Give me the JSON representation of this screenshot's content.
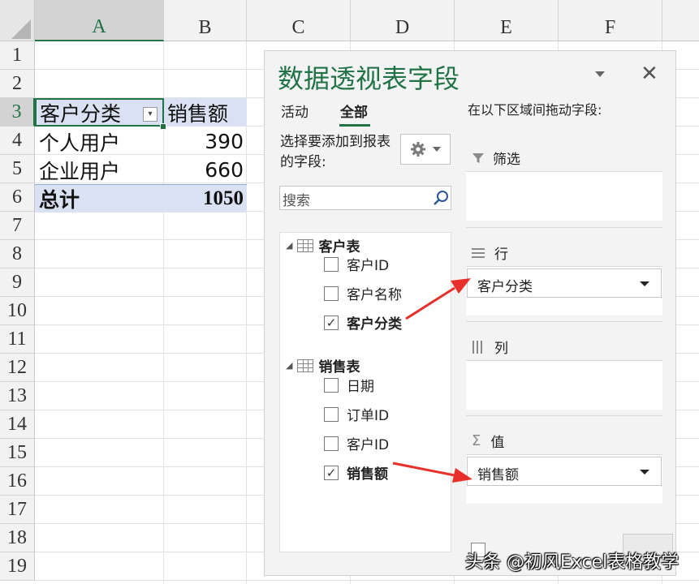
{
  "spreadsheet": {
    "columns": [
      "A",
      "B",
      "C",
      "D",
      "E",
      "F"
    ],
    "rows": [
      "1",
      "2",
      "3",
      "4",
      "5",
      "6",
      "7",
      "8",
      "9",
      "10",
      "11",
      "12",
      "13",
      "14",
      "15",
      "16",
      "17",
      "18",
      "19"
    ],
    "pivot": {
      "header_label": "客户分类",
      "header_value": "销售额",
      "rows": [
        {
          "label": "个人用户",
          "value": "390"
        },
        {
          "label": "企业用户",
          "value": "660"
        }
      ],
      "total_label": "总计",
      "total_value": "1050"
    },
    "accent_color": "#217346",
    "band_color": "#d9e1f2"
  },
  "pane": {
    "title": "数据透视表字段",
    "tabs": [
      "活动",
      "全部"
    ],
    "active_tab": "全部",
    "choose_label": "选择要添加到报表的字段:",
    "search_placeholder": "搜索",
    "tables": [
      {
        "name": "客户表",
        "fields": [
          {
            "label": "客户ID",
            "checked": false
          },
          {
            "label": "客户名称",
            "checked": false
          },
          {
            "label": "客户分类",
            "checked": true
          }
        ]
      },
      {
        "name": "销售表",
        "fields": [
          {
            "label": "日期",
            "checked": false
          },
          {
            "label": "订单ID",
            "checked": false
          },
          {
            "label": "客户ID",
            "checked": false
          },
          {
            "label": "销售额",
            "checked": true
          }
        ]
      }
    ],
    "drag_label": "在以下区域间拖动字段:",
    "areas": {
      "filters": "筛选",
      "rows": "行",
      "columns": "列",
      "values": "值"
    },
    "rows_chip": "客户分类",
    "values_chip": "销售额",
    "arrow_color": "#e8302a"
  },
  "watermark": "头条 @初风Excel表格教学",
  "icons": {
    "filter": "funnel-icon",
    "rows": "rows-icon",
    "columns": "columns-icon",
    "values": "sigma-icon",
    "gear": "gear-icon",
    "search": "search-icon",
    "close": "close-icon"
  }
}
